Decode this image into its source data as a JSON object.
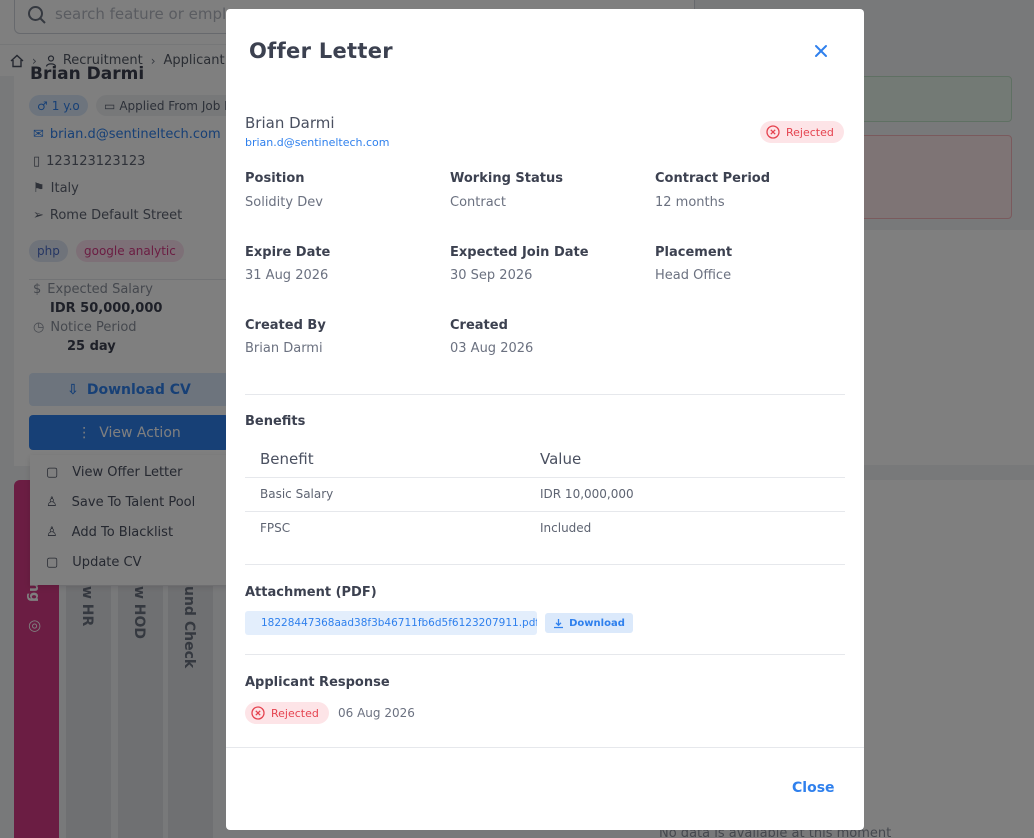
{
  "background": {
    "search_placeholder": "search feature or employ",
    "breadcrumb": [
      "Recruitment",
      "Applicant"
    ],
    "candidate": {
      "name_peek": "Brian Darmi",
      "experience": "1 y.o",
      "applied_from": "Applied From Job P",
      "email": "brian.d@sentineltech.com",
      "phone": "123123123123",
      "country": "Italy",
      "address": "Rome Default Street",
      "skills": [
        "php",
        "google analytic"
      ],
      "expected_salary_label": "Expected Salary",
      "expected_salary": "IDR 50,000,000",
      "notice_period_label": "Notice Period",
      "notice_period": "25 day"
    },
    "download_cv": "Download CV",
    "view_action": "View Action",
    "action_menu": [
      "View Offer Letter",
      "Save To Talent Pool",
      "Add To Blacklist",
      "Update CV"
    ],
    "pipeline_columns": [
      "ng",
      "w HR",
      "w HOD",
      "und Check"
    ],
    "no_data": "No data is available at this moment"
  },
  "modal": {
    "title": "Offer Letter",
    "applicant_name": "Brian Darmi",
    "applicant_email": "brian.d@sentineltech.com",
    "status": "Rejected",
    "fields": {
      "position_label": "Position",
      "position": "Solidity Dev",
      "working_status_label": "Working Status",
      "working_status": "Contract",
      "contract_period_label": "Contract Period",
      "contract_period": "12 months",
      "expire_date_label": "Expire Date",
      "expire_date": "31 Aug 2026",
      "expected_join_label": "Expected Join Date",
      "expected_join": "30 Sep 2026",
      "placement_label": "Placement",
      "placement": "Head Office",
      "created_by_label": "Created By",
      "created_by": "Brian Darmi",
      "created_label": "Created",
      "created": "03 Aug 2026"
    },
    "benefits_title": "Benefits",
    "benefits_table": {
      "headers": [
        "Benefit",
        "Value"
      ],
      "rows": [
        [
          "Basic Salary",
          "IDR 10,000,000"
        ],
        [
          "FPSC",
          "Included"
        ]
      ]
    },
    "attachment_title": "Attachment (PDF)",
    "attachment_file": "18228447368aad38f3b46711fb6d5f6123207911.pdf",
    "attachment_download": "Download",
    "response_title": "Applicant Response",
    "response_status": "Rejected",
    "response_date": "06 Aug 2026",
    "close_label": "Close"
  },
  "colors": {
    "primary": "#2f80ed",
    "danger": "#e5434f",
    "pink": "#d63b86"
  }
}
